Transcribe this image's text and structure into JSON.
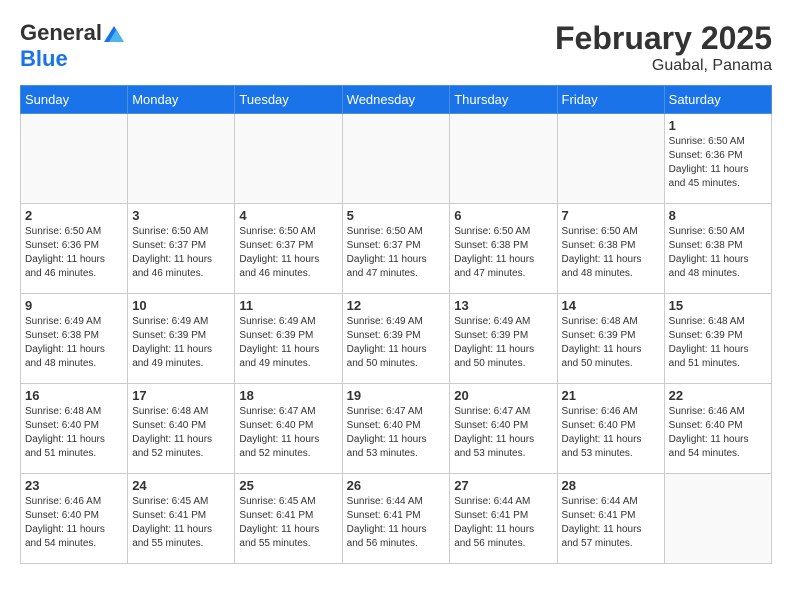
{
  "logo": {
    "general": "General",
    "blue": "Blue"
  },
  "title": "February 2025",
  "location": "Guabal, Panama",
  "days_of_week": [
    "Sunday",
    "Monday",
    "Tuesday",
    "Wednesday",
    "Thursday",
    "Friday",
    "Saturday"
  ],
  "weeks": [
    [
      {
        "day": "",
        "info": ""
      },
      {
        "day": "",
        "info": ""
      },
      {
        "day": "",
        "info": ""
      },
      {
        "day": "",
        "info": ""
      },
      {
        "day": "",
        "info": ""
      },
      {
        "day": "",
        "info": ""
      },
      {
        "day": "1",
        "info": "Sunrise: 6:50 AM\nSunset: 6:36 PM\nDaylight: 11 hours\nand 45 minutes."
      }
    ],
    [
      {
        "day": "2",
        "info": "Sunrise: 6:50 AM\nSunset: 6:36 PM\nDaylight: 11 hours\nand 46 minutes."
      },
      {
        "day": "3",
        "info": "Sunrise: 6:50 AM\nSunset: 6:37 PM\nDaylight: 11 hours\nand 46 minutes."
      },
      {
        "day": "4",
        "info": "Sunrise: 6:50 AM\nSunset: 6:37 PM\nDaylight: 11 hours\nand 46 minutes."
      },
      {
        "day": "5",
        "info": "Sunrise: 6:50 AM\nSunset: 6:37 PM\nDaylight: 11 hours\nand 47 minutes."
      },
      {
        "day": "6",
        "info": "Sunrise: 6:50 AM\nSunset: 6:38 PM\nDaylight: 11 hours\nand 47 minutes."
      },
      {
        "day": "7",
        "info": "Sunrise: 6:50 AM\nSunset: 6:38 PM\nDaylight: 11 hours\nand 48 minutes."
      },
      {
        "day": "8",
        "info": "Sunrise: 6:50 AM\nSunset: 6:38 PM\nDaylight: 11 hours\nand 48 minutes."
      }
    ],
    [
      {
        "day": "9",
        "info": "Sunrise: 6:49 AM\nSunset: 6:38 PM\nDaylight: 11 hours\nand 48 minutes."
      },
      {
        "day": "10",
        "info": "Sunrise: 6:49 AM\nSunset: 6:39 PM\nDaylight: 11 hours\nand 49 minutes."
      },
      {
        "day": "11",
        "info": "Sunrise: 6:49 AM\nSunset: 6:39 PM\nDaylight: 11 hours\nand 49 minutes."
      },
      {
        "day": "12",
        "info": "Sunrise: 6:49 AM\nSunset: 6:39 PM\nDaylight: 11 hours\nand 50 minutes."
      },
      {
        "day": "13",
        "info": "Sunrise: 6:49 AM\nSunset: 6:39 PM\nDaylight: 11 hours\nand 50 minutes."
      },
      {
        "day": "14",
        "info": "Sunrise: 6:48 AM\nSunset: 6:39 PM\nDaylight: 11 hours\nand 50 minutes."
      },
      {
        "day": "15",
        "info": "Sunrise: 6:48 AM\nSunset: 6:39 PM\nDaylight: 11 hours\nand 51 minutes."
      }
    ],
    [
      {
        "day": "16",
        "info": "Sunrise: 6:48 AM\nSunset: 6:40 PM\nDaylight: 11 hours\nand 51 minutes."
      },
      {
        "day": "17",
        "info": "Sunrise: 6:48 AM\nSunset: 6:40 PM\nDaylight: 11 hours\nand 52 minutes."
      },
      {
        "day": "18",
        "info": "Sunrise: 6:47 AM\nSunset: 6:40 PM\nDaylight: 11 hours\nand 52 minutes."
      },
      {
        "day": "19",
        "info": "Sunrise: 6:47 AM\nSunset: 6:40 PM\nDaylight: 11 hours\nand 53 minutes."
      },
      {
        "day": "20",
        "info": "Sunrise: 6:47 AM\nSunset: 6:40 PM\nDaylight: 11 hours\nand 53 minutes."
      },
      {
        "day": "21",
        "info": "Sunrise: 6:46 AM\nSunset: 6:40 PM\nDaylight: 11 hours\nand 53 minutes."
      },
      {
        "day": "22",
        "info": "Sunrise: 6:46 AM\nSunset: 6:40 PM\nDaylight: 11 hours\nand 54 minutes."
      }
    ],
    [
      {
        "day": "23",
        "info": "Sunrise: 6:46 AM\nSunset: 6:40 PM\nDaylight: 11 hours\nand 54 minutes."
      },
      {
        "day": "24",
        "info": "Sunrise: 6:45 AM\nSunset: 6:41 PM\nDaylight: 11 hours\nand 55 minutes."
      },
      {
        "day": "25",
        "info": "Sunrise: 6:45 AM\nSunset: 6:41 PM\nDaylight: 11 hours\nand 55 minutes."
      },
      {
        "day": "26",
        "info": "Sunrise: 6:44 AM\nSunset: 6:41 PM\nDaylight: 11 hours\nand 56 minutes."
      },
      {
        "day": "27",
        "info": "Sunrise: 6:44 AM\nSunset: 6:41 PM\nDaylight: 11 hours\nand 56 minutes."
      },
      {
        "day": "28",
        "info": "Sunrise: 6:44 AM\nSunset: 6:41 PM\nDaylight: 11 hours\nand 57 minutes."
      },
      {
        "day": "",
        "info": ""
      }
    ]
  ]
}
